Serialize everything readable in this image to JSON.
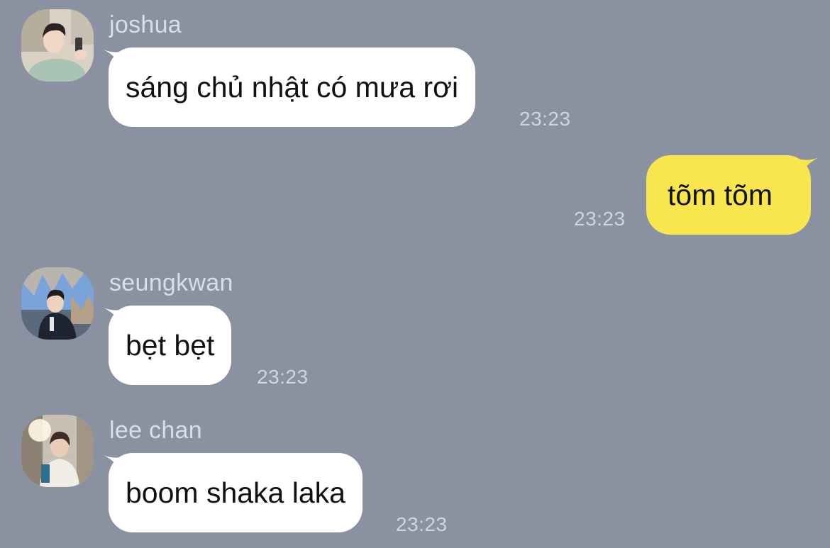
{
  "colors": {
    "background": "#8a91a1",
    "incoming_bubble": "#ffffff",
    "outgoing_bubble": "#f9e64f",
    "name_text": "#d9dde6",
    "time_text": "#d0d4dd"
  },
  "messages": [
    {
      "direction": "incoming",
      "sender": "joshua",
      "text": "sáng chủ nhật có mưa rơi",
      "time": "23:23",
      "avatar_icon": "joshua-avatar"
    },
    {
      "direction": "outgoing",
      "text": "tõm tõm",
      "time": "23:23"
    },
    {
      "direction": "incoming",
      "sender": "seungkwan",
      "text": "bẹt bẹt",
      "time": "23:23",
      "avatar_icon": "seungkwan-avatar"
    },
    {
      "direction": "incoming",
      "sender": "lee chan",
      "text": "boom shaka laka",
      "time": "23:23",
      "avatar_icon": "lee-chan-avatar"
    }
  ]
}
